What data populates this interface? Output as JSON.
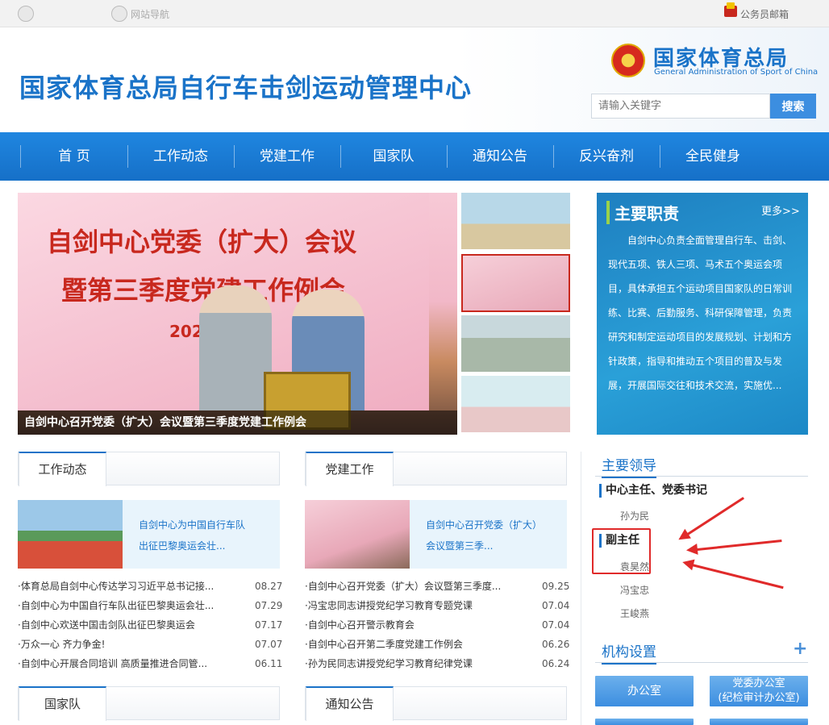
{
  "topbar": {
    "left_link": "网站导航",
    "mail": "公务员邮箱"
  },
  "header": {
    "title": "国家体育总局自行车击剑运动管理中心",
    "logo_cn": "国家体育总局",
    "logo_en": "General Administration of Sport of China",
    "search_placeholder": "请输入关键字",
    "search_button": "搜索"
  },
  "nav": [
    "首 页",
    "工作动态",
    "党建工作",
    "国家队",
    "通知公告",
    "反兴奋剂",
    "全民健身"
  ],
  "hero": {
    "screen_line1": "自剑中心党委（扩大）会议",
    "screen_line2": "暨第三季度党建工作例会",
    "screen_year": "2024",
    "caption": "自剑中心召开党委（扩大）会议暨第三季度党建工作例会"
  },
  "duties": {
    "title": "主要职责",
    "more": "更多>>",
    "text": "自剑中心负责全面管理自行车、击剑、现代五项、铁人三项、马术五个奥运会项目，具体承担五个运动项目国家队的日常训练、比赛、后勤服务、科研保障管理，负责研究和制定运动项目的发展规划、计划和方针政策，指导和推动五个项目的普及与发展，开展国际交往和技术交流，实施优..."
  },
  "work_news": {
    "tab": "工作动态",
    "featured": "自剑中心为中国自行车队出征巴黎奥运会壮...",
    "items": [
      {
        "title": "·体育总局自剑中心传达学习习近平总书记接...",
        "date": "08.27"
      },
      {
        "title": "·自剑中心为中国自行车队出征巴黎奥运会壮...",
        "date": "07.29"
      },
      {
        "title": "·自剑中心欢送中国击剑队出征巴黎奥运会",
        "date": "07.17"
      },
      {
        "title": "·万众一心 齐力争金!",
        "date": "07.07"
      },
      {
        "title": "·自剑中心开展合同培训 高质量推进合同管...",
        "date": "06.11"
      }
    ]
  },
  "party_news": {
    "tab": "党建工作",
    "featured": "自剑中心召开党委（扩大）会议暨第三季...",
    "items": [
      {
        "title": "·自剑中心召开党委（扩大）会议暨第三季度...",
        "date": "09.25"
      },
      {
        "title": "·冯宝忠同志讲授党纪学习教育专题党课",
        "date": "07.04"
      },
      {
        "title": "·自剑中心召开警示教育会",
        "date": "07.04"
      },
      {
        "title": "·自剑中心召开第二季度党建工作例会",
        "date": "06.26"
      },
      {
        "title": "·孙为民同志讲授党纪学习教育纪律党课",
        "date": "06.24"
      }
    ]
  },
  "lower_tabs": {
    "national_team": "国家队",
    "notice": "通知公告"
  },
  "leaders": {
    "title": "主要领导",
    "role1": "中心主任、党委书记",
    "name1": "孙为民",
    "role2": "副主任",
    "deputies": [
      "袁昊然",
      "冯宝忠",
      "王峻燕"
    ]
  },
  "org": {
    "title": "机构设置",
    "plus": "+",
    "office": "办公室",
    "party_office_line1": "党委办公室",
    "party_office_line2": "(纪检审计办公室)"
  },
  "colors": {
    "brand_blue": "#1a73c8",
    "nav_blue": "#1f86e0",
    "highlight_red": "#e02a2a"
  }
}
